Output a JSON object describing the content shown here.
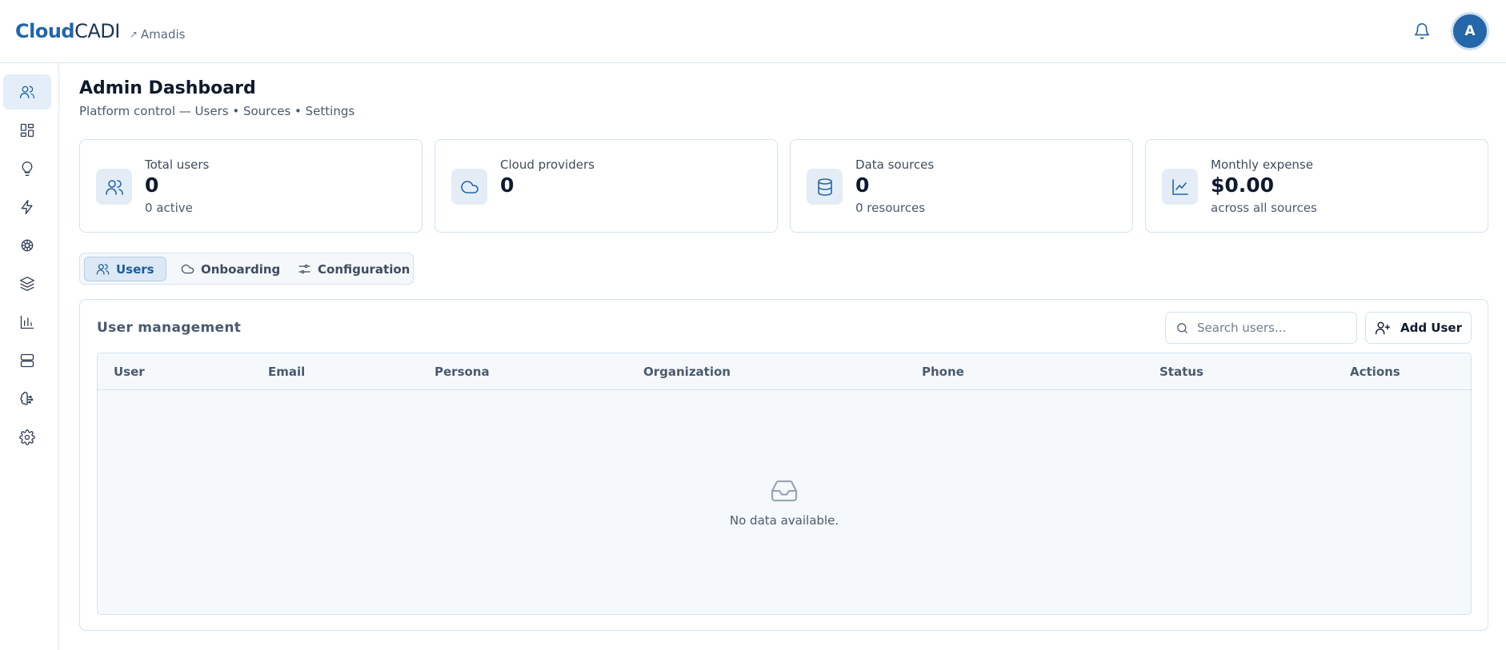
{
  "app": {
    "brand_bold": "Cloud",
    "brand_light": "CADI",
    "tenant": "Amadis",
    "avatar_initial": "A"
  },
  "page": {
    "title": "Admin Dashboard",
    "subtitle": "Platform control — Users • Sources • Settings"
  },
  "stats": [
    {
      "label": "Total users",
      "value": "0",
      "sub": "0 active",
      "icon": "users-icon"
    },
    {
      "label": "Cloud providers",
      "value": "0",
      "sub": "",
      "icon": "cloud-icon"
    },
    {
      "label": "Data sources",
      "value": "0",
      "sub": "0 resources",
      "icon": "database-icon"
    },
    {
      "label": "Monthly expense",
      "value": "$0.00",
      "sub": "across all sources",
      "icon": "trend-icon"
    }
  ],
  "tabs": [
    {
      "label": "Users",
      "active": true,
      "icon": "users-icon"
    },
    {
      "label": "Onboarding",
      "active": false,
      "icon": "cloud-icon"
    },
    {
      "label": "Configuration",
      "active": false,
      "icon": "sliders-icon"
    }
  ],
  "panel": {
    "title": "User management",
    "search_placeholder": "Search users...",
    "add_label": "Add User",
    "columns": [
      "User",
      "Email",
      "Persona",
      "Organization",
      "Phone",
      "Status",
      "Actions"
    ],
    "empty_text": "No data available."
  },
  "sidebar": [
    "users-icon",
    "grid-icon",
    "lightbulb-icon",
    "bolt-icon",
    "network-icon",
    "layers-icon",
    "bar-chart-icon",
    "server-icon",
    "brain-icon",
    "gear-icon"
  ],
  "colors": {
    "accent": "#2466a8",
    "active_bg": "#e3eef8",
    "border": "#d3e2f0"
  }
}
